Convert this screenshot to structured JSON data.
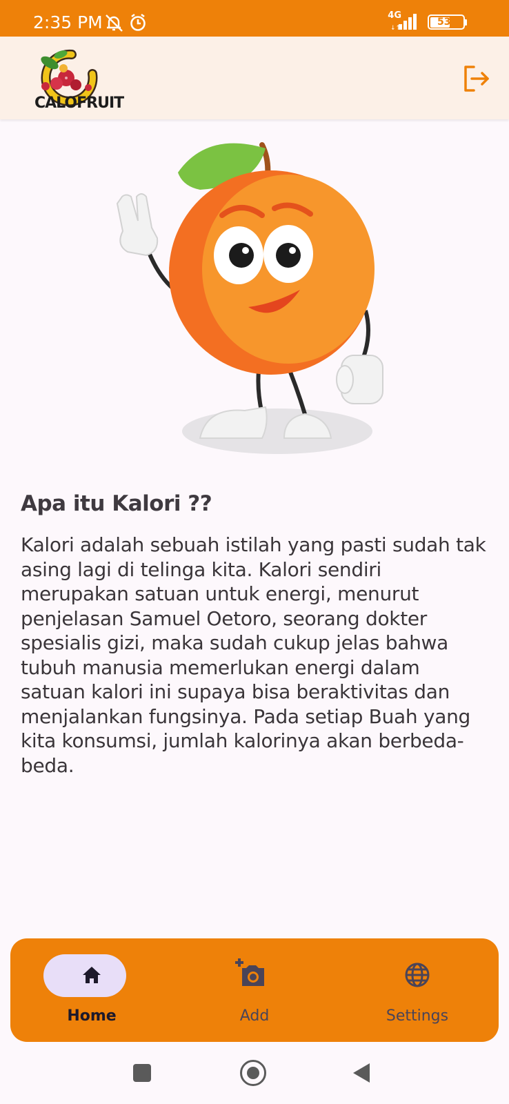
{
  "status_bar": {
    "time": "2:35 PM",
    "network": "4G",
    "battery": "53",
    "icons": [
      "silent-notification-icon",
      "alarm-icon",
      "signal-icon",
      "battery-icon"
    ]
  },
  "app_bar": {
    "logo_text": "CALOFRUIT",
    "logout_icon": "logout-icon"
  },
  "content": {
    "heading": "Apa itu Kalori ??",
    "body": "Kalori adalah sebuah istilah yang pasti sudah tak asing lagi di telinga kita. Kalori sendiri merupakan satuan untuk energi, menurut penjelasan Samuel Oetoro, seorang dokter spesialis gizi, maka sudah cukup jelas bahwa tubuh manusia memerlukan energi dalam satuan kalori ini supaya bisa beraktivitas dan menjalankan fungsinya. Pada setiap Buah yang kita konsumsi, jumlah kalorinya akan berbeda-beda."
  },
  "bottom_nav": {
    "items": [
      {
        "label": "Home",
        "icon": "home-icon",
        "active": true
      },
      {
        "label": "Add",
        "icon": "add-photo-icon",
        "active": false
      },
      {
        "label": "Settings",
        "icon": "globe-icon",
        "active": false
      }
    ]
  },
  "colors": {
    "primary": "#ee8109",
    "app_bar": "#fcf0e7",
    "background": "#fdf8fc",
    "active_pill": "#e8def8",
    "text": "#3a3539"
  }
}
